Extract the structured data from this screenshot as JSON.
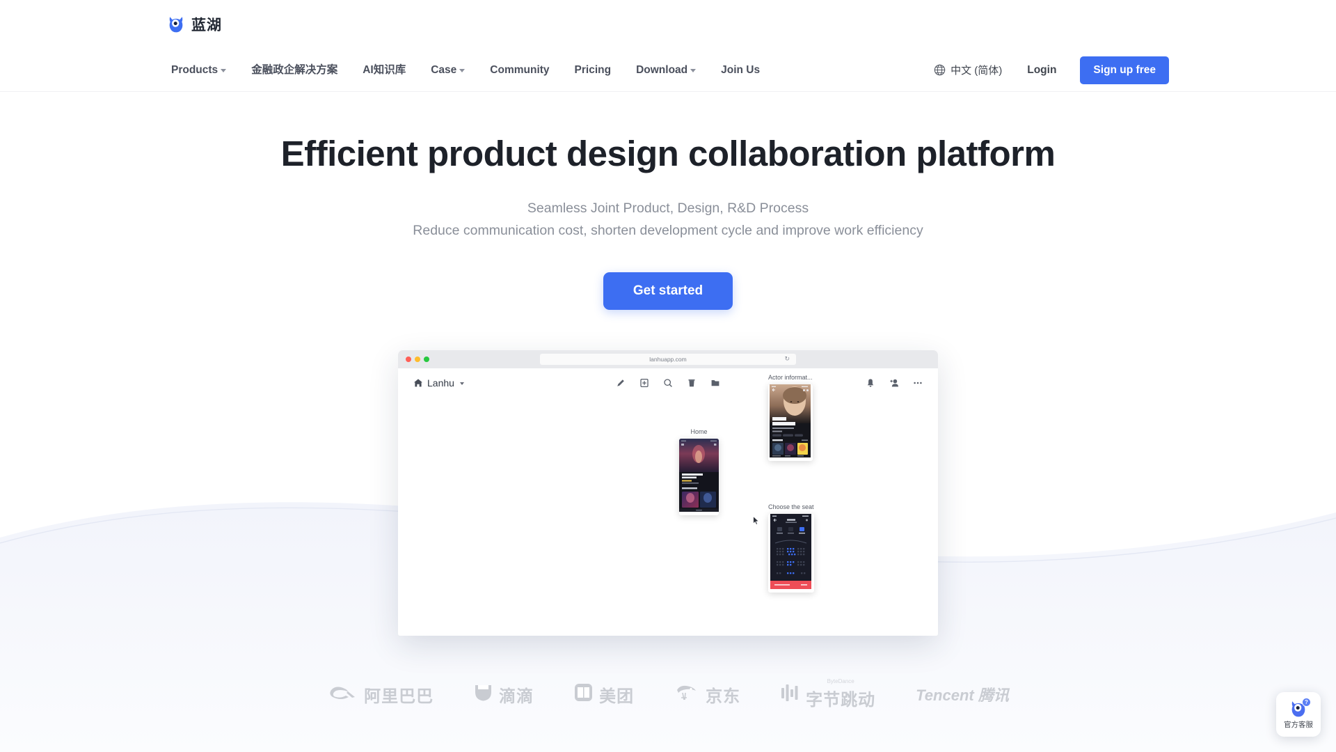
{
  "brand": {
    "logo_icon": "owl-mascot-icon",
    "name": "蓝湖"
  },
  "nav": {
    "items": [
      {
        "label": "Products",
        "has_dropdown": true
      },
      {
        "label": "金融政企解决方案",
        "has_dropdown": false
      },
      {
        "label": "AI知识库",
        "has_dropdown": false
      },
      {
        "label": "Case",
        "has_dropdown": true
      },
      {
        "label": "Community",
        "has_dropdown": false
      },
      {
        "label": "Pricing",
        "has_dropdown": false
      },
      {
        "label": "Download",
        "has_dropdown": true
      },
      {
        "label": "Join Us",
        "has_dropdown": false
      }
    ],
    "language": {
      "icon": "globe-icon",
      "label": "中文 (简体)"
    },
    "login_label": "Login",
    "signup_label": "Sign up free"
  },
  "hero": {
    "title": "Efficient product design collaboration platform",
    "subtitle_1": "Seamless Joint Product, Design, R&D Process",
    "subtitle_2": "Reduce communication cost, shorten development cycle and improve work efficiency",
    "cta_label": "Get started"
  },
  "mockup": {
    "browser": {
      "url": "lanhuapp.com",
      "reload_icon": "refresh-icon",
      "traffic_lights": [
        "close-red",
        "minimize-yellow",
        "zoom-green"
      ]
    },
    "app": {
      "home_label": "Lanhu",
      "home_icon": "home-icon",
      "tools": [
        "pen-icon",
        "add-frame-icon",
        "search-icon",
        "delete-icon",
        "folder-icon"
      ],
      "right_tools": [
        "bell-icon",
        "add-member-icon",
        "more-icon"
      ]
    },
    "cards": [
      {
        "label": "Home",
        "screen": "movie-home-screen",
        "title": "Mulan On The Grand Express"
      },
      {
        "label": "Actor informat...",
        "screen": "actor-profile-screen",
        "name_line1": "Khloe",
        "name_line2": "Kardashian"
      },
      {
        "label": "Choose the seat",
        "screen": "seat-selection-screen"
      }
    ]
  },
  "clients": [
    {
      "icon": "alibaba-logo-icon",
      "name": "阿里巴巴",
      "latin": false
    },
    {
      "icon": "didi-logo-icon",
      "name": "滴滴",
      "latin": false
    },
    {
      "icon": "meituan-logo-icon",
      "name": "美团",
      "latin": false
    },
    {
      "icon": "jd-logo-icon",
      "name": "京东",
      "latin": false
    },
    {
      "icon": "bytedance-logo-icon",
      "name": "字节跳动",
      "sup": "ByteDance",
      "latin": false
    },
    {
      "icon": "tencent-logo-icon",
      "name": "Tencent 腾讯",
      "latin": true
    }
  ],
  "support": {
    "icon": "owl-mascot-icon",
    "badge": "?",
    "label": "官方客服"
  },
  "colors": {
    "accent": "#3d6ef2",
    "title": "#1d2129",
    "muted": "#8a8f99",
    "client_grey": "#c9ccd2"
  }
}
